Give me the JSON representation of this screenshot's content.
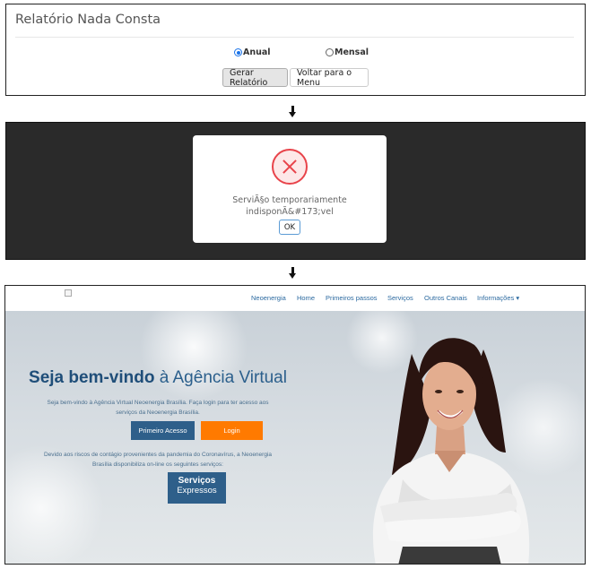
{
  "panel1": {
    "title": "Relatório Nada Consta",
    "radio_anual": "Anual",
    "radio_mensal": "Mensal",
    "selected": "Anual",
    "generate_button": "Gerar Relatório",
    "back_button": "Voltar para o Menu"
  },
  "panel2": {
    "message_line1": "ServiÃ§o temporariamente",
    "message_line2": "indisponÃ&#173;vel",
    "ok_button": "OK",
    "icon": "error-x-icon"
  },
  "panel3": {
    "nav": [
      "Neoenergia",
      "Home",
      "Primeiros passos",
      "Serviços",
      "Outros Canais",
      "Informações ▾"
    ],
    "hero_title_bold": "Seja bem-vindo",
    "hero_title_rest": " à Agência Virtual",
    "intro_line1": "Seja bem-vindo à Agência Virtual Neoenergia Brasília. Faça login para ter acesso aos",
    "intro_line2": "serviços da Neoenergia Brasília.",
    "first_access_button": "Primeiro Acesso",
    "login_button": "Login",
    "covid_line1": "Devido aos riscos de contágio provenientes da pandemia do Coronavírus, a Neoenergia",
    "covid_line2": "Brasília disponibiliza on-line os seguintes serviços:",
    "services_line1": "Serviços",
    "services_line2": "Expressos"
  },
  "colors": {
    "brand_blue": "#2e5f8a",
    "login_orange": "#ff7a00",
    "error_red": "#e8434a",
    "overlay": "#2a2a2a"
  }
}
